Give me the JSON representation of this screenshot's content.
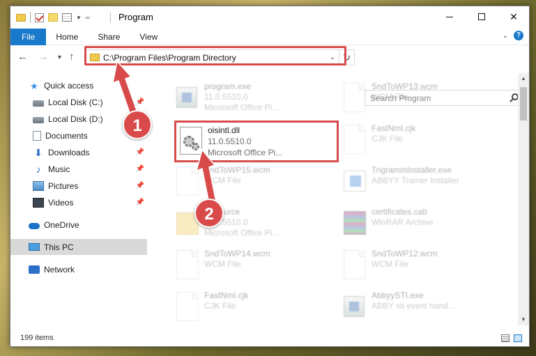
{
  "window": {
    "title": "Program"
  },
  "ribbon": {
    "tabs": [
      "File",
      "Home",
      "Share",
      "View"
    ]
  },
  "address": {
    "path": "C:\\Program Files\\Program Directory"
  },
  "search": {
    "placeholder": "Search Program"
  },
  "sidebar": {
    "items": [
      {
        "label": "Quick access",
        "icon": "star-icon"
      },
      {
        "label": "Local Disk (C:)",
        "icon": "disk-icon",
        "pinned": true
      },
      {
        "label": "Local Disk (D:)",
        "icon": "disk-icon"
      },
      {
        "label": "Documents",
        "icon": "documents-icon",
        "pinned": true
      },
      {
        "label": "Downloads",
        "icon": "download-icon",
        "pinned": true
      },
      {
        "label": "Music",
        "icon": "music-icon",
        "pinned": true
      },
      {
        "label": "Pictures",
        "icon": "pictures-icon",
        "pinned": true
      },
      {
        "label": "Videos",
        "icon": "videos-icon",
        "pinned": true
      },
      {
        "label": "OneDrive",
        "icon": "onedrive-icon"
      },
      {
        "label": "This PC",
        "icon": "pc-icon",
        "selected": true
      },
      {
        "label": "Network",
        "icon": "network-icon"
      }
    ]
  },
  "files": [
    {
      "name": "program.exe",
      "line2": "11.0.5510.0",
      "line3": "Microsoft Office Pi...",
      "icon": "exe-icon"
    },
    {
      "name": "SndToWP13.wcm",
      "line2": "WCM File",
      "line3": "",
      "icon": "document-icon"
    },
    {
      "name": "oisintl.dll",
      "line2": "11.0.5510.0",
      "line3": "Microsoft Office Pi...",
      "icon": "dll-gear-icon",
      "selected": true
    },
    {
      "name": "FastNmI.cjk",
      "line2": "CJK File",
      "line3": "",
      "icon": "document-icon"
    },
    {
      "name": "SndToWP15.wcm",
      "line2": "WCM File",
      "line3": "",
      "icon": "document-icon"
    },
    {
      "name": "TrigrammInstaller.exe",
      "line2": "ABBYY Trainer Installer",
      "line3": "",
      "icon": "installer-icon"
    },
    {
      "name": "Resource",
      "line2": "11.0.5510.0",
      "line3": "Microsoft Office Pi...",
      "icon": "folder-icon"
    },
    {
      "name": "certificates.cab",
      "line2": "WinRAR Archive",
      "line3": "",
      "icon": "winrar-icon"
    },
    {
      "name": "SndToWP14.wcm",
      "line2": "WCM File",
      "line3": "",
      "icon": "document-icon"
    },
    {
      "name": "SndToWP12.wcm",
      "line2": "WCM File",
      "line3": "",
      "icon": "document-icon"
    },
    {
      "name": "FastNmI.cjk",
      "line2": "CJK File",
      "line3": "",
      "icon": "document-icon"
    },
    {
      "name": "AbbyySTI.exe",
      "line2": "ABBY sti event hand...",
      "line3": "",
      "icon": "exe-icon"
    }
  ],
  "status": {
    "item_count": "199 items"
  },
  "callouts": {
    "one": "1",
    "two": "2"
  },
  "colors": {
    "accent": "#1979ca",
    "highlight": "#d94a4a"
  }
}
